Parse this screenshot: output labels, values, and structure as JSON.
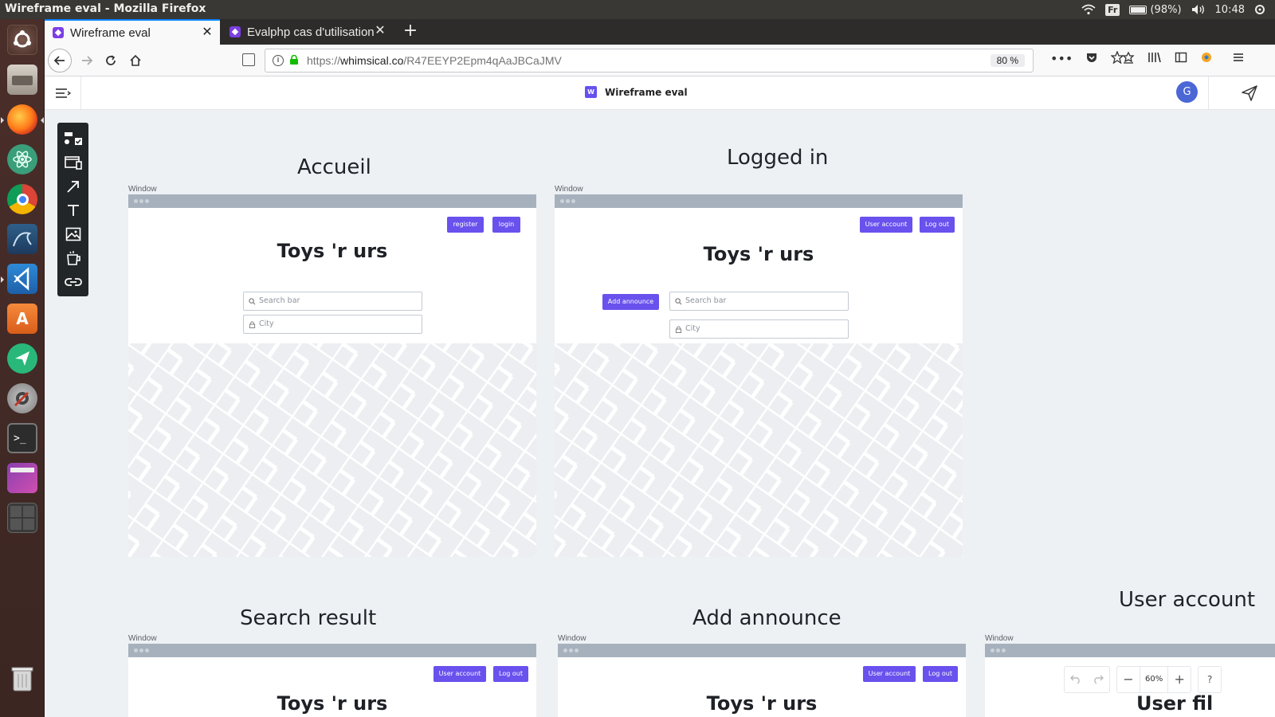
{
  "os": {
    "window_title": "Wireframe eval - Mozilla Firefox",
    "keyboard_layout": "Fr",
    "battery": "(98%)",
    "clock": "10:48"
  },
  "launcher": {
    "apps": [
      "ubuntu-dash",
      "files",
      "firefox",
      "atom",
      "chrome",
      "mysql-workbench",
      "vscode",
      "software-center",
      "send-app",
      "system-tools",
      "terminal",
      "screenshot",
      "workspaces",
      "trash"
    ]
  },
  "browser": {
    "tabs": [
      {
        "label": "Wireframe eval",
        "active": true
      },
      {
        "label": "Evalphp cas d'utilisation",
        "active": false
      }
    ],
    "url_prefix": "https://",
    "url_host": "whimsical.co",
    "url_path": "/R47EEYP2Epm4qAaJBCaJMV",
    "zoom": "80 %"
  },
  "app": {
    "doc_badge": "W",
    "doc_title": "Wireframe eval",
    "avatar_initial": "G",
    "accent": "#6951ee"
  },
  "boards": {
    "accueil": {
      "title": "Accueil",
      "window_label": "Window",
      "register": "register",
      "login": "login",
      "brand": "Toys 'r urs",
      "search_placeholder": "Search bar",
      "city_placeholder": "City"
    },
    "logged_in": {
      "title": "Logged in",
      "window_label": "Window",
      "user_account": "User account",
      "log_out": "Log out",
      "brand": "Toys 'r urs",
      "add_announce": "Add announce",
      "search_placeholder": "Search bar",
      "city_placeholder": "City"
    },
    "search_result": {
      "title": "Search result",
      "window_label": "Window",
      "user_account": "User account",
      "log_out": "Log out",
      "brand": "Toys 'r urs"
    },
    "add_announce": {
      "title": "Add announce",
      "window_label": "Window",
      "user_account": "User account",
      "log_out": "Log out",
      "brand": "Toys 'r urs"
    },
    "user_account": {
      "title": "User account",
      "window_label": "Window",
      "brand": "User fil"
    }
  },
  "zoom_controls": {
    "level": "60%",
    "help": "?"
  }
}
